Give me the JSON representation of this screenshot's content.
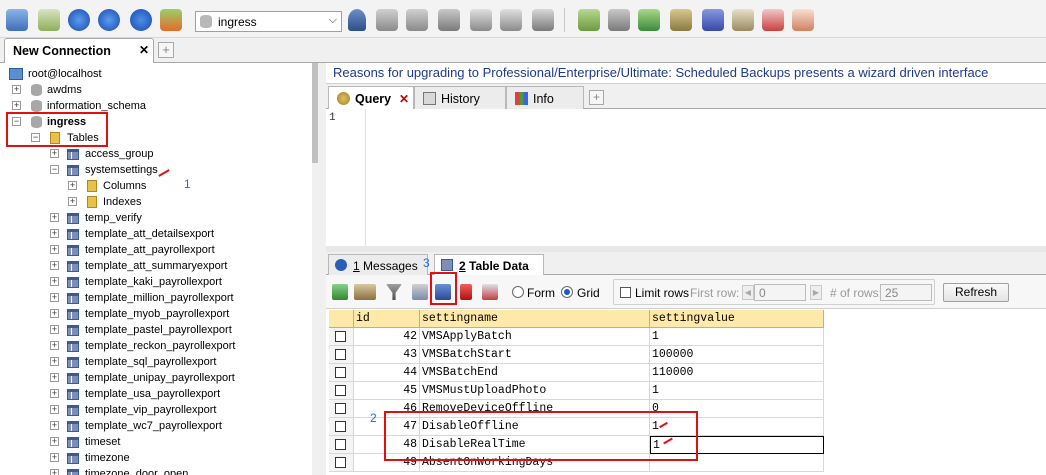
{
  "toolbar": {
    "database": "ingress",
    "icons": [
      "connect-icon",
      "new-connection-icon",
      "execute-query-icon",
      "execute-all-icon",
      "refresh-icon",
      "new-query-icon",
      "user-manager-icon",
      "new-db-icon",
      "new-table-icon",
      "import-icon",
      "backup-icon",
      "schema-icon",
      "table-icon",
      "query-builder-icon",
      "copy-db-icon",
      "sync-icon",
      "import-wizard-icon",
      "migration-icon",
      "notifications-icon",
      "schedule-icon",
      "schema-designer-icon"
    ]
  },
  "connection_tab": {
    "label": "New Connection",
    "close": "✕",
    "add": "+"
  },
  "tree": {
    "root": "root@localhost",
    "databases": [
      "awdms",
      "information_schema"
    ],
    "active_db": "ingress",
    "tables_label": "Tables",
    "tables_before": [
      "access_group"
    ],
    "expanded_table": "systemsettings",
    "expanded_children": [
      "Columns",
      "Indexes"
    ],
    "tables_after": [
      "temp_verify",
      "template_att_detailsexport",
      "template_att_payrollexport",
      "template_att_summaryexport",
      "template_kaki_payrollexport",
      "template_million_payrollexport",
      "template_myob_payrollexport",
      "template_pastel_payrollexport",
      "template_reckon_payrollexport",
      "template_sql_payrollexport",
      "template_unipay_payrollexport",
      "template_usa_payrollexport",
      "template_vip_payrollexport",
      "template_wc7_payrollexport",
      "timeset",
      "timezone",
      "timezone_door_open"
    ]
  },
  "notice": "Reasons for upgrading to Professional/Enterprise/Ultimate: Scheduled Backups presents a wizard driven interface",
  "query_tabs": [
    {
      "label": "Query",
      "close": "✕"
    },
    {
      "label": "History"
    },
    {
      "label": "Info"
    }
  ],
  "query_tab_add": "+",
  "editor": {
    "line_numbers": [
      "1"
    ]
  },
  "result_tabs": [
    {
      "number": "1",
      "label": " Messages"
    },
    {
      "number": "2",
      "label": " Table Data"
    }
  ],
  "data_toolbar": {
    "form_label": "Form",
    "grid_label": "Grid",
    "view_mode": "Grid",
    "limit_rows_label": "Limit rows",
    "first_row_label": "First row:",
    "first_row_value": "0",
    "num_rows_label": "# of rows:",
    "num_rows_value": "25",
    "refresh_label": "Refresh"
  },
  "grid": {
    "columns": [
      "id",
      "settingname",
      "settingvalue"
    ],
    "rows": [
      {
        "id": "42",
        "settingname": "VMSApplyBatch",
        "settingvalue": "1"
      },
      {
        "id": "43",
        "settingname": "VMSBatchStart",
        "settingvalue": "100000"
      },
      {
        "id": "44",
        "settingname": "VMSBatchEnd",
        "settingvalue": "110000"
      },
      {
        "id": "45",
        "settingname": "VMSMustUploadPhoto",
        "settingvalue": "1"
      },
      {
        "id": "46",
        "settingname": "RemoveDeviceOffline",
        "settingvalue": "0"
      },
      {
        "id": "47",
        "settingname": "DisableOffline",
        "settingvalue": "1"
      },
      {
        "id": "48",
        "settingname": "DisableRealTime",
        "settingvalue": "1"
      },
      {
        "id": "49",
        "settingname": "AbsentOnWorkingDays",
        "settingvalue": ""
      }
    ]
  },
  "annotations": {
    "step1": "1",
    "step2": "2",
    "step3": "3",
    "highlight_color": "#e01010",
    "number_color": "#1a6fe0"
  }
}
